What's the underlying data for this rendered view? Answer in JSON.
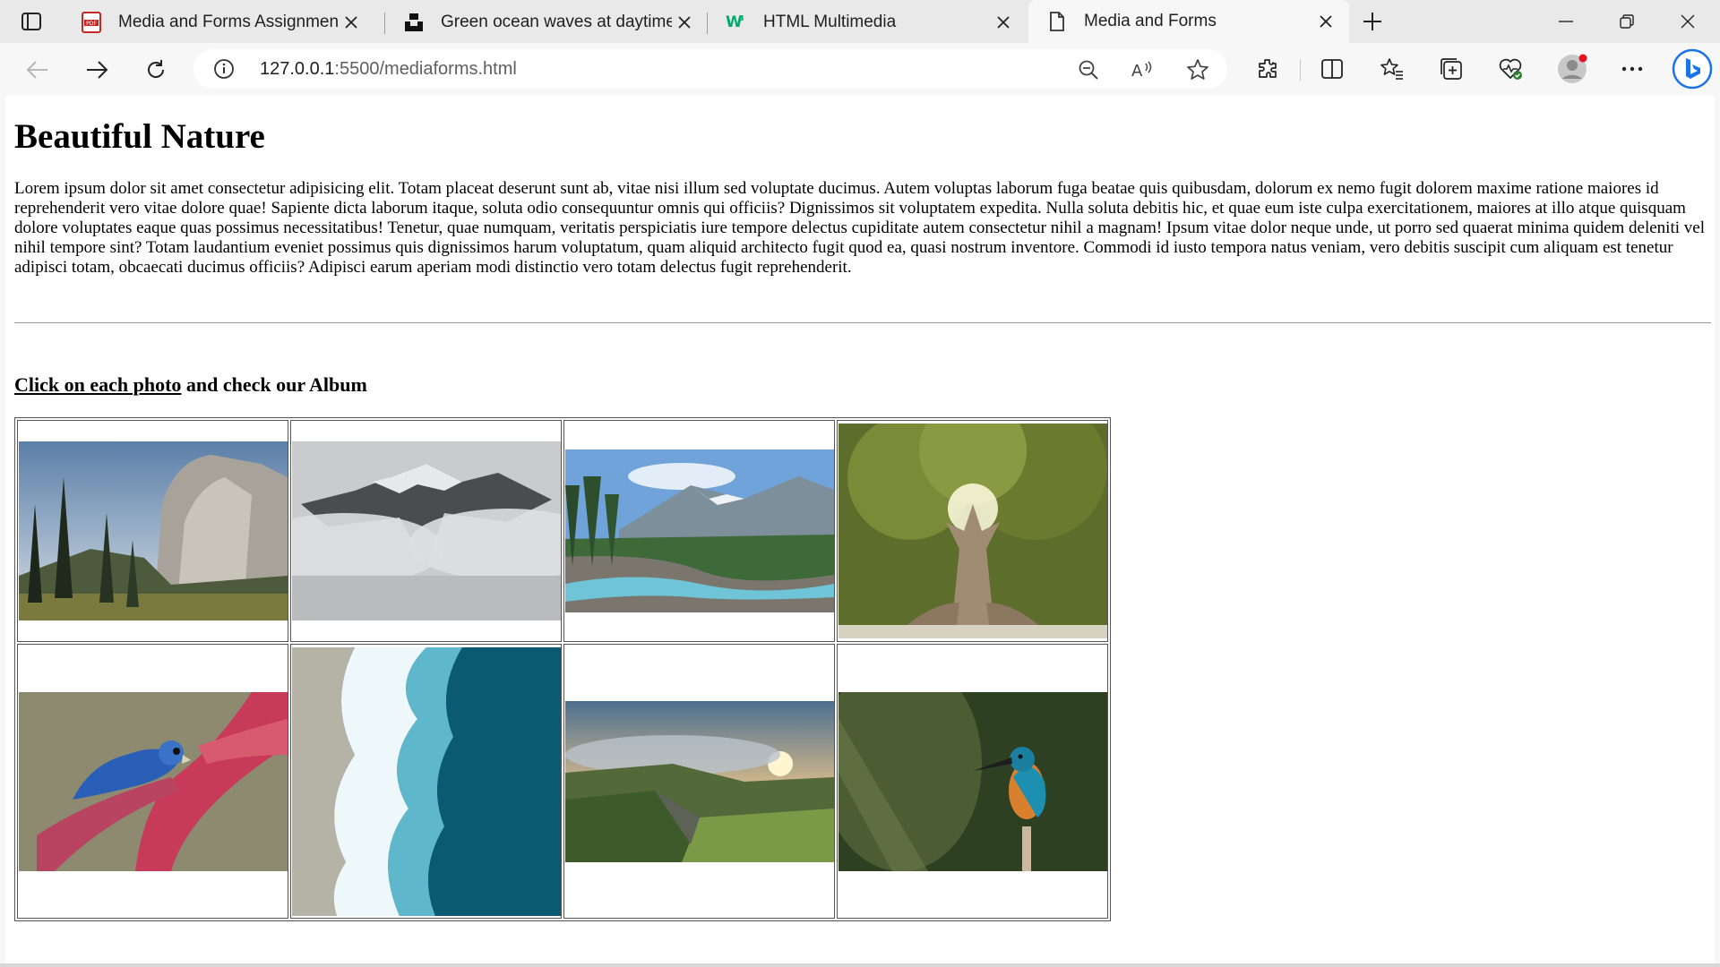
{
  "browser": {
    "tabs": [
      {
        "title": "Media and Forms Assignment.pdf",
        "icon": "pdf-icon",
        "active": false
      },
      {
        "title": "Green ocean waves at daytime photo",
        "icon": "unsplash-icon",
        "active": false
      },
      {
        "title": "HTML Multimedia",
        "icon": "w3schools-icon",
        "active": false
      },
      {
        "title": "Media and Forms",
        "icon": "document-icon",
        "active": true
      }
    ],
    "address": {
      "host": "127.0.0.1",
      "rest": ":5500/mediaforms.html"
    },
    "accent": "#1a73e8"
  },
  "page": {
    "title": "Beautiful Nature",
    "paragraph": "Lorem ipsum dolor sit amet consectetur adipisicing elit. Totam placeat deserunt sunt ab, vitae nisi illum sed voluptate ducimus. Autem voluptas laborum fuga beatae quis quibusdam, dolorum ex nemo fugit dolorem maxime ratione maiores id reprehenderit vero vitae dolore quae! Sapiente dicta laborum itaque, soluta odio consequuntur omnis qui officiis? Dignissimos sit voluptatem expedita. Nulla soluta debitis hic, et quae eum iste culpa exercitationem, maiores at illo atque quisquam dolore voluptates eaque quas possimus necessitatibus! Tenetur, quae numquam, veritatis perspiciatis iure tempore delectus cupiditate autem consectetur nihil a magnam! Ipsum vitae dolor neque unde, ut porro sed quaerat minima quidem deleniti vel nihil tempore sint? Totam laudantium eveniet possimus quis dignissimos harum voluptatum, quam aliquid architecto fugit quod ea, quasi nostrum inventore. Commodi id iusto tempora natus veniam, vero debitis suscipit cum aliquam est tenetur adipisci totam, obcaecati ducimus officiis? Adipisci earum aperiam modi distinctio vero totam delectus fugit reprehenderit.",
    "album_link": "Click on each photo",
    "album_rest": " and check our Album",
    "photos": [
      "yosemite-cliff-photo",
      "misty-mountain-photo",
      "mountain-river-photo",
      "giant-tree-photo",
      "blue-lovebird-photo",
      "ocean-waves-photo",
      "green-valley-sunset-photo",
      "kingfisher-photo"
    ]
  }
}
